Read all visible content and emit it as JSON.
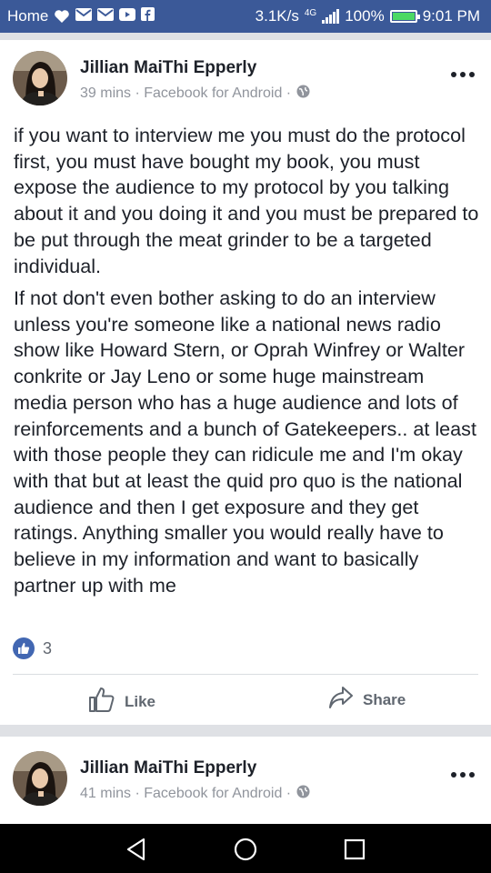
{
  "status_bar": {
    "home_label": "Home",
    "speed": "3.1K/s",
    "network": "4G",
    "battery": "100%",
    "time": "9:01 PM"
  },
  "posts": [
    {
      "author": "Jillian MaiThi Epperly",
      "meta": "39 mins · Facebook for Android ·",
      "paragraphs": [
        "if you want to interview me you must do the protocol first, you must have bought my book, you must expose the audience to my protocol by you talking about it and you doing it and you must be prepared to be put through the meat grinder to be a targeted individual.",
        "If not don't even bother asking to do an interview unless you're someone like a national news radio show like Howard Stern, or Oprah Winfrey or Walter conkrite or Jay Leno or some huge mainstream media person who has a huge audience and lots of reinforcements and a bunch of Gatekeepers.. at least with those people they can ridicule me and I'm okay with that but at least the quid pro quo is the national audience and then I get exposure and they get ratings. Anything smaller you would really have to believe in my information and want to basically partner up with me"
      ],
      "like_count": "3",
      "actions": {
        "like": "Like",
        "share": "Share"
      }
    },
    {
      "author": "Jillian MaiThi Epperly",
      "meta": "41 mins · Facebook for Android ·"
    }
  ],
  "colors": {
    "brand_blue": "#3b5998",
    "like_blue": "#4267b2",
    "text": "#1d2129",
    "meta_gray": "#90949c",
    "feed_background": "#dfe1e5"
  },
  "icons": [
    "heart-icon",
    "mail-icon",
    "video-icon",
    "facebook-icon",
    "signal-icon",
    "battery-icon",
    "more-icon",
    "globe-icon",
    "thumbs-up-icon",
    "share-icon",
    "back-icon",
    "home-icon",
    "recents-icon"
  ]
}
